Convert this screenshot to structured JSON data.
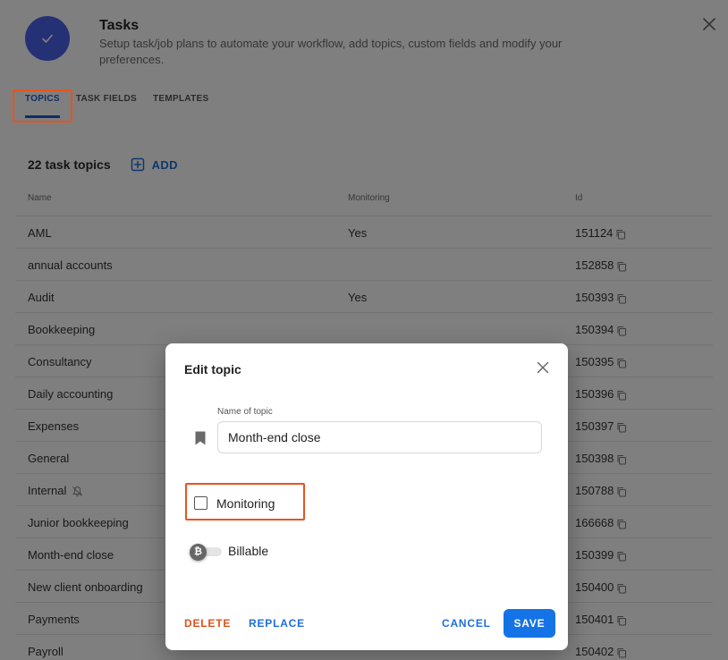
{
  "header": {
    "title": "Tasks",
    "subtitle": "Setup task/job plans to automate your workflow, add topics, custom fields and modify your preferences."
  },
  "tabs": [
    {
      "label": "TOPICS",
      "active": true
    },
    {
      "label": "TASK FIELDS",
      "active": false
    },
    {
      "label": "TEMPLATES",
      "active": false
    }
  ],
  "topics": {
    "count_label": "22 task topics",
    "add_label": "ADD",
    "columns": {
      "name": "Name",
      "monitoring": "Monitoring",
      "id": "Id"
    },
    "rows": [
      {
        "name": "AML",
        "monitoring": "Yes",
        "id": "151124"
      },
      {
        "name": "annual accounts",
        "monitoring": "",
        "id": "152858"
      },
      {
        "name": "Audit",
        "monitoring": "Yes",
        "id": "150393"
      },
      {
        "name": "Bookkeeping",
        "monitoring": "",
        "id": "150394"
      },
      {
        "name": "Consultancy",
        "monitoring": "",
        "id": "150395"
      },
      {
        "name": "Daily accounting",
        "monitoring": "",
        "id": "150396"
      },
      {
        "name": "Expenses",
        "monitoring": "",
        "id": "150397"
      },
      {
        "name": "General",
        "monitoring": "",
        "id": "150398"
      },
      {
        "name": "Internal",
        "monitoring": "",
        "id": "150788",
        "muted": true
      },
      {
        "name": "Junior bookkeeping",
        "monitoring": "",
        "id": "166668"
      },
      {
        "name": "Month-end close",
        "monitoring": "",
        "id": "150399"
      },
      {
        "name": "New client onboarding",
        "monitoring": "",
        "id": "150400"
      },
      {
        "name": "Payments",
        "monitoring": "",
        "id": "150401"
      },
      {
        "name": "Payroll",
        "monitoring": "",
        "id": "150402"
      }
    ]
  },
  "dialog": {
    "title": "Edit topic",
    "name_label": "Name of topic",
    "name_value": "Month-end close",
    "monitoring_label": "Monitoring",
    "monitoring_checked": false,
    "billable_label": "Billable",
    "billable_on": false,
    "billable_symbol": "₿",
    "delete_label": "DELETE",
    "replace_label": "REPLACE",
    "cancel_label": "CANCEL",
    "save_label": "SAVE"
  },
  "colors": {
    "accent": "#1473e6",
    "danger": "#d9531e",
    "highlight": "#e8541e",
    "logo": "#4a63ea"
  }
}
